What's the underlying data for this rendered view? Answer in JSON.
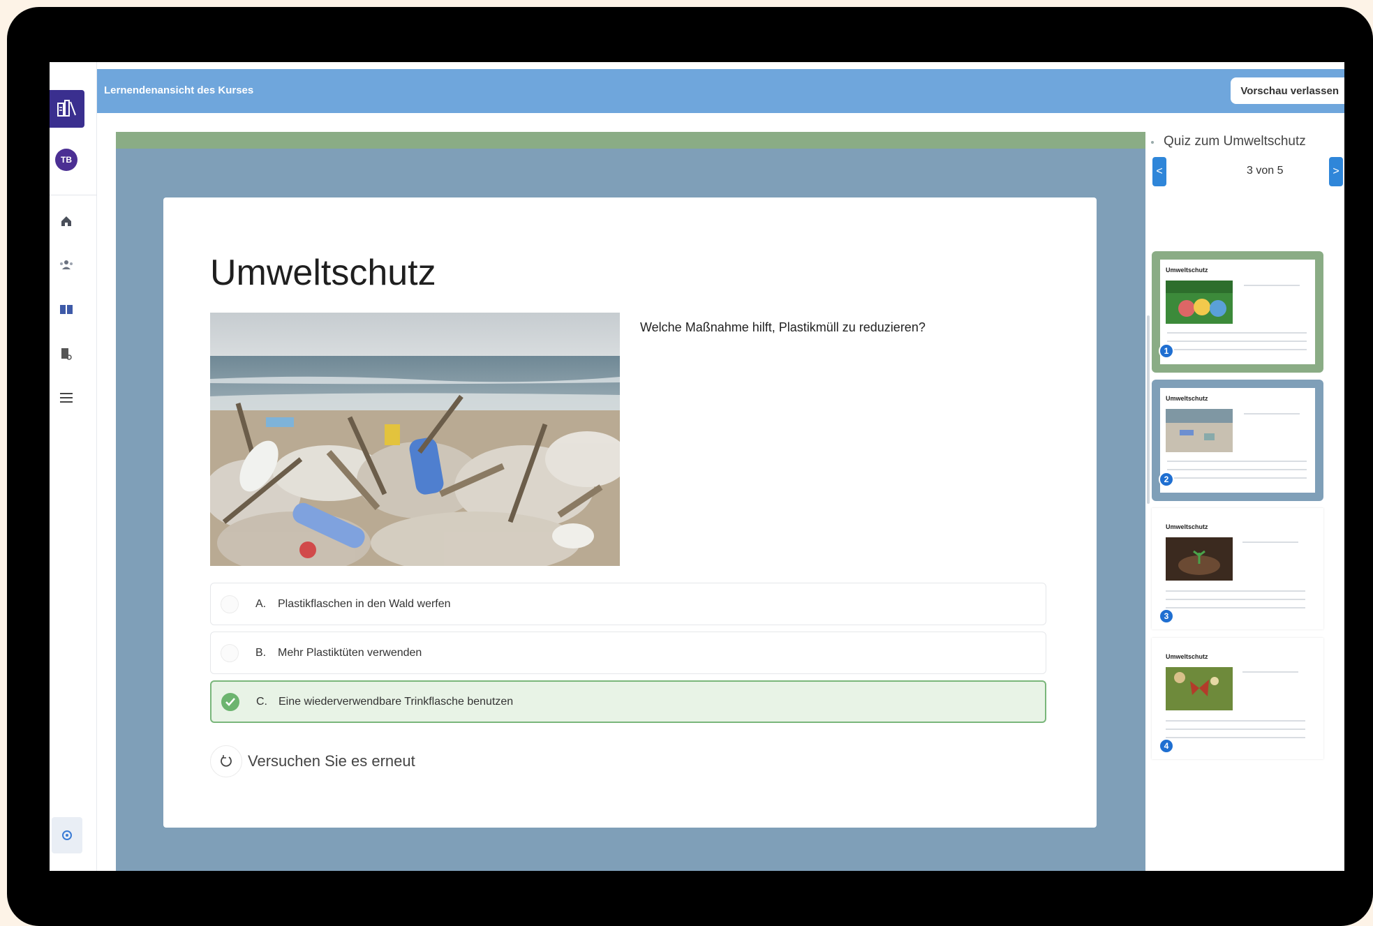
{
  "header": {
    "title": "Lernendenansicht des Kurses",
    "exit_button": "Vorschau verlassen"
  },
  "rail": {
    "avatar_initials": "TB",
    "icons": [
      "home-icon",
      "group-icon",
      "book-icon",
      "report-icon",
      "menu-icon",
      "support-icon"
    ]
  },
  "quiz": {
    "title": "Umweltschutz",
    "question": "Welche Maßnahme hilft, Plastikmüll zu reduzieren?",
    "options": [
      {
        "letter": "A.",
        "text": "Plastikflaschen in den Wald werfen",
        "selected": false
      },
      {
        "letter": "B.",
        "text": "Mehr Plastiktüten verwenden",
        "selected": false
      },
      {
        "letter": "C.",
        "text": "Eine wiederverwendbare Trinkflasche benutzen",
        "selected": true
      }
    ],
    "retry_label": "Versuchen Sie es erneut"
  },
  "panel": {
    "breadcrumb": "Quiz zum Umweltschutz",
    "pager": "3 von 5",
    "prev": "<",
    "next": ">",
    "thumbnails": [
      {
        "title": "Umweltschutz",
        "number": "1",
        "state": "current"
      },
      {
        "title": "Umweltschutz",
        "number": "2",
        "state": "visited"
      },
      {
        "title": "Umweltschutz",
        "number": "3",
        "state": "plain"
      },
      {
        "title": "Umweltschutz",
        "number": "4",
        "state": "plain"
      }
    ]
  },
  "colors": {
    "header": "#6fa6dc",
    "stage": "#7f9fb8",
    "progress": "#8aac85",
    "selected_option": "#e8f3e6",
    "accent": "#2f86d9"
  }
}
